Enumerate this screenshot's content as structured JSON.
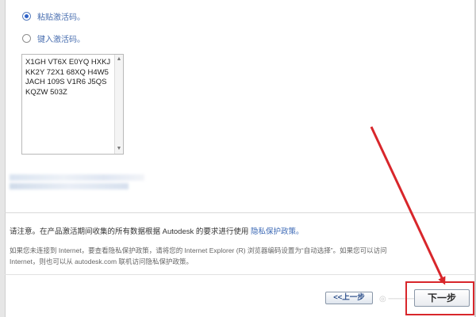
{
  "options": {
    "paste_label": "粘贴激活码。",
    "type_label": "键入激活码。"
  },
  "activation_code": {
    "lines": [
      "X1GH VT6X E0YQ HXKJ",
      "KK2Y 72X1 68XQ H4W5",
      "JACH 109S V1R6 J5QS",
      "KQZW 503Z"
    ]
  },
  "notice": {
    "text": "请注意。在产品激活期间收集的所有数据根据 Autodesk 的要求进行使用",
    "link": "隐私保护政策。",
    "detail_line1": "如果您未连接到 Internet，要查看隐私保护政策，请将您的 Internet Explorer (R) 浏览器编码设置为“自动选择”。如果您可以访问",
    "detail_line2": "Internet，则也可以从 autodesk.com 联机访问隐私保护政策。"
  },
  "nav": {
    "prev_label": "<<上一步",
    "next_label": "下一步"
  },
  "colors": {
    "annotation_red": "#d8262b",
    "link_blue": "#3b68b5"
  }
}
